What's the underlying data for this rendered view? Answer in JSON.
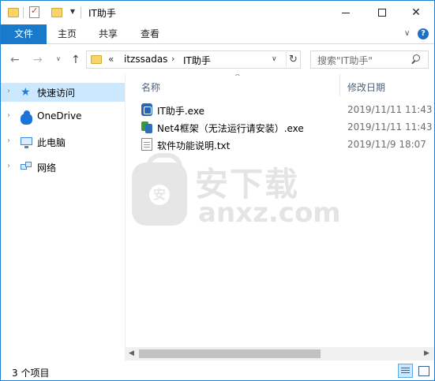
{
  "window": {
    "title": "IT助手",
    "controls": {
      "minimize": "minimize",
      "maximize": "maximize",
      "close": "✕"
    }
  },
  "quick_access_toolbar": {
    "items": [
      "folder-icon",
      "properties-icon",
      "new-folder-icon",
      "customize-dropdown"
    ],
    "dropdown_glyph": "▼"
  },
  "ribbon": {
    "tabs": [
      {
        "label": "文件",
        "active": true
      },
      {
        "label": "主页",
        "active": false
      },
      {
        "label": "共享",
        "active": false
      },
      {
        "label": "查看",
        "active": false
      }
    ],
    "expand_glyph": "∨",
    "help_glyph": "?"
  },
  "navigation": {
    "back_glyph": "←",
    "forward_glyph": "→",
    "recent_glyph": "∨",
    "up_glyph": "↑",
    "address": {
      "overflow": "«",
      "crumbs": [
        "itzssadas",
        "IT助手"
      ],
      "separator": "›",
      "dropdown_glyph": "∨",
      "refresh_glyph": "↻"
    },
    "search": {
      "placeholder": "搜索\"IT助手\""
    }
  },
  "sidebar": {
    "items": [
      {
        "label": "快速访问",
        "icon": "star-icon",
        "selected": true
      },
      {
        "label": "OneDrive",
        "icon": "cloud-icon",
        "selected": false
      },
      {
        "label": "此电脑",
        "icon": "computer-icon",
        "selected": false
      },
      {
        "label": "网络",
        "icon": "network-icon",
        "selected": false
      }
    ],
    "expand_glyph": "›"
  },
  "content": {
    "columns": {
      "name": "名称",
      "date": "修改日期",
      "sort_glyph": "^"
    },
    "files": [
      {
        "name": "IT助手.exe",
        "date": "2019/11/11 11:43",
        "icon": "app-exe-icon"
      },
      {
        "name": "Net4框架（无法运行请安装）.exe",
        "date": "2019/11/11 11:43",
        "icon": "installer-icon"
      },
      {
        "name": "软件功能说明.txt",
        "date": "2019/11/9 18:07",
        "icon": "text-file-icon"
      }
    ],
    "watermark": {
      "shield_glyph": "安",
      "cn": "安下载",
      "en": "anxz.com"
    }
  },
  "scrollbar": {
    "left_glyph": "◀",
    "right_glyph": "▶"
  },
  "status": {
    "item_count": "3 个项目",
    "views": [
      "details-view",
      "large-icons-view"
    ]
  },
  "colors": {
    "accent": "#1979ca",
    "selection": "#cce8ff",
    "header_text": "#4c607a",
    "window_border": "#1e7fd6"
  }
}
